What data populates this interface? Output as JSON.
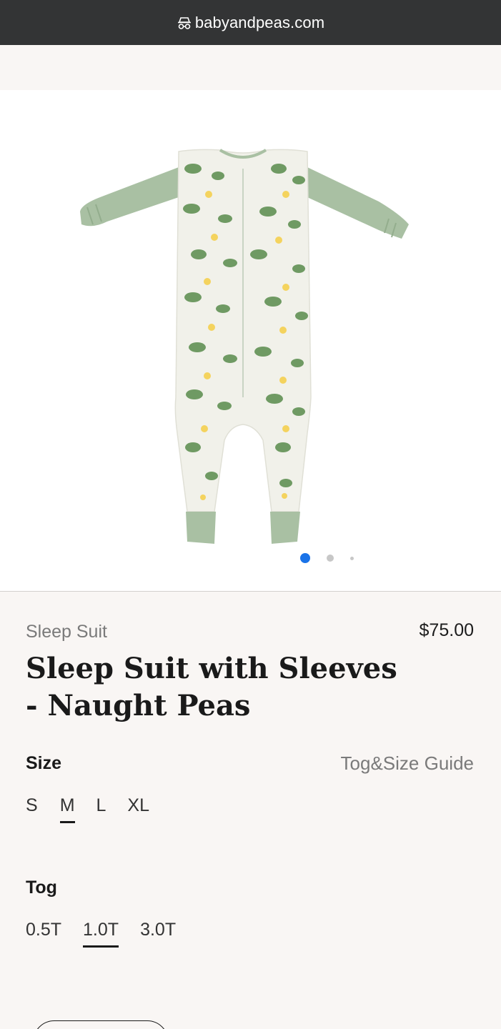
{
  "browser": {
    "url": "babyandpeas.com",
    "site_icon": "incognito-icon"
  },
  "gallery": {
    "image_alt": "Sleep Suit with Sleeves - Naught Peas",
    "slides": 3,
    "active_slide": 1,
    "colors": {
      "fabric": "#f1f1ea",
      "sleeve": "#a9c0a3",
      "pea": "#6f9a63",
      "flower": "#f4d35e",
      "active_dot": "#1a73e8"
    }
  },
  "product": {
    "category": "Sleep Suit",
    "price": "$75.00",
    "title_line1": "Sleep Suit with Sleeves",
    "title_line2": "- Naught Peas"
  },
  "size": {
    "label": "Size",
    "guide_link": "Tog&Size Guide",
    "options": [
      "S",
      "M",
      "L",
      "XL"
    ],
    "selected": "M"
  },
  "tog": {
    "label": "Tog",
    "options": [
      "0.5T",
      "1.0T",
      "3.0T"
    ],
    "selected": "1.0T"
  }
}
